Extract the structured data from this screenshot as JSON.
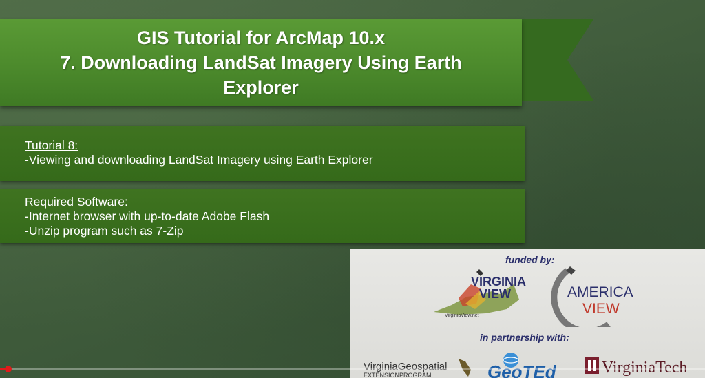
{
  "title": {
    "line1": "GIS Tutorial for ArcMap 10.x",
    "line2": "7. Downloading LandSat Imagery Using Earth",
    "line3": "Explorer"
  },
  "box1": {
    "heading": "Tutorial 8:",
    "line1": "-Viewing and downloading LandSat Imagery using Earth Explorer"
  },
  "box2": {
    "heading": "Required Software:",
    "line1": "-Internet browser with up-to-date Adobe Flash",
    "line2": "-Unzip program such as 7-Zip"
  },
  "sponsors": {
    "funded_by": "funded by:",
    "partnership": "in partnership with:",
    "virginiaview": {
      "line1": "VIRGINIA",
      "line2": "VIEW",
      "url": "VirginiaView.net"
    },
    "americaview": {
      "line1": "AMERICA",
      "line2": "VIEW"
    },
    "vgep": {
      "line1": "VirginiaGeospatial",
      "line2": "EXTENSIONPROGRAM"
    },
    "geoted": "GeoTEd",
    "virginiatech": "VirginiaTech"
  },
  "video": {
    "progress": 0.012
  },
  "colors": {
    "banner_green": "#4c8a2c",
    "box_green": "#3a6e1c",
    "background": "#3f5b3b",
    "progress": "#e21b1b"
  }
}
